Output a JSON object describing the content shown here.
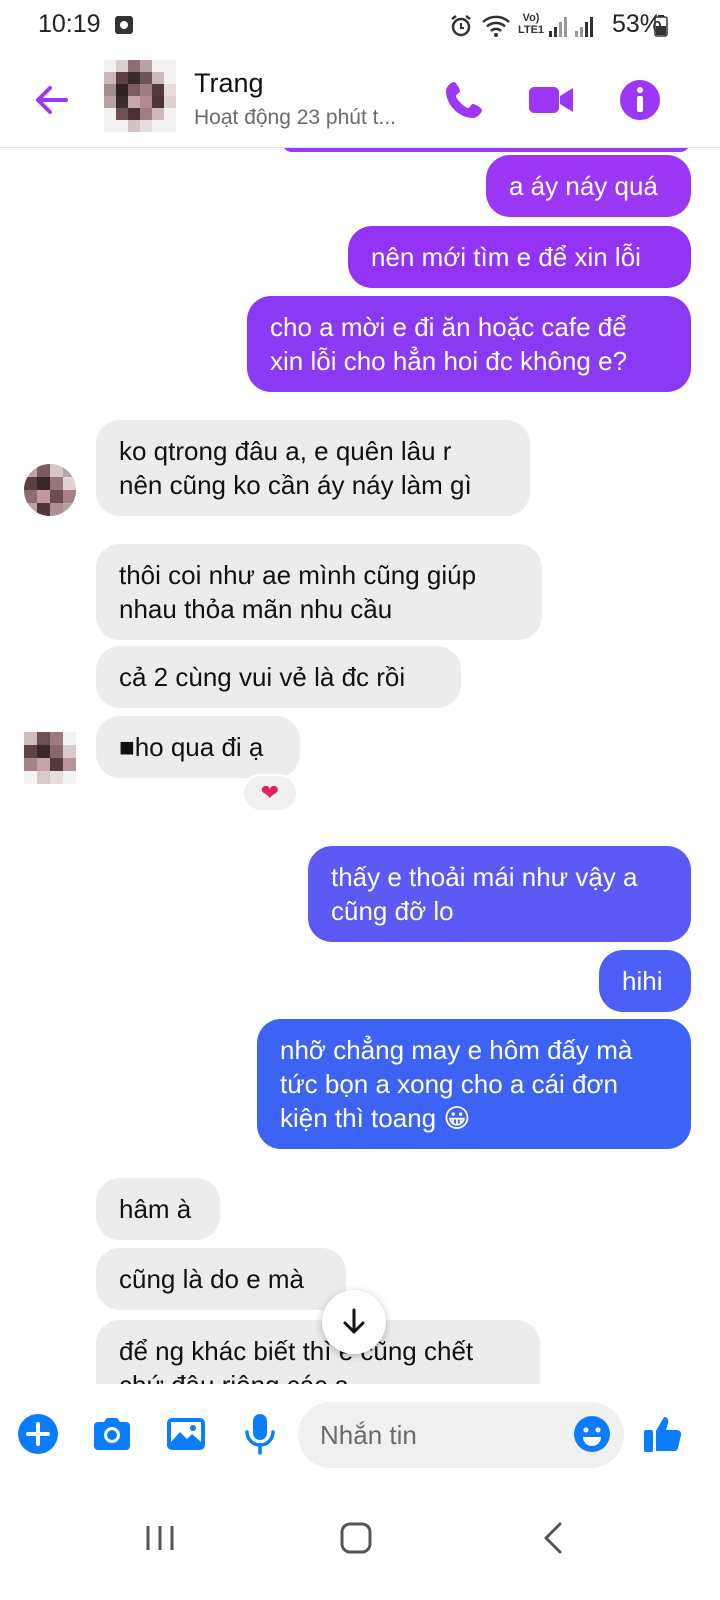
{
  "status_bar": {
    "time": "10:19",
    "network": "Vo) LTE1",
    "battery_text": "53%"
  },
  "header": {
    "contact_name": "Trang",
    "contact_status": "Hoạt động 23 phút t..."
  },
  "colors": {
    "purple": "#9b37f5",
    "violet": "#7a49f5",
    "blue": "#3d63f4",
    "incoming": "#ececec",
    "accent_icon": "#9b37f5",
    "composer_icon": "#0a7cff"
  },
  "messages": [
    {
      "id": "m1",
      "dir": "out",
      "text": "a áy náy quá"
    },
    {
      "id": "m2",
      "dir": "out",
      "text": "nên mới tìm e để xin lỗi"
    },
    {
      "id": "m3",
      "dir": "out",
      "text": "cho a mời e đi ăn hoặc cafe để\nxin lỗi cho hẳn hoi đc không e?"
    },
    {
      "id": "m4",
      "dir": "in",
      "text": "ko qtrong đâu a, e quên lâu r\nnên cũng ko cần áy náy làm gì"
    },
    {
      "id": "m5",
      "dir": "in",
      "text": "thôi coi như ae mình cũng giúp\nnhau thỏa mãn nhu cầu"
    },
    {
      "id": "m6",
      "dir": "in",
      "text": "cả 2 cùng vui vẻ là đc rồi"
    },
    {
      "id": "m7",
      "dir": "in",
      "text": "■ho qua đi ạ",
      "reaction": "❤"
    },
    {
      "id": "m8",
      "dir": "out",
      "text": "thấy e thoải mái như vậy a\ncũng đỡ lo"
    },
    {
      "id": "m9",
      "dir": "out",
      "text": "hihi"
    },
    {
      "id": "m10",
      "dir": "out",
      "text": "nhỡ chẳng may e hôm đấy mà\ntức bọn a xong cho a cái đơn\nkiện thì toang 😀"
    },
    {
      "id": "m11",
      "dir": "in",
      "text": "hâm à"
    },
    {
      "id": "m12",
      "dir": "in",
      "text": "cũng là do e mà"
    },
    {
      "id": "m13",
      "dir": "in",
      "text": "để ng khác biết thì e cũng chết\nchứ đâu riêng các a"
    }
  ],
  "composer": {
    "placeholder": "Nhắn tin"
  },
  "icons": {
    "back": "arrow-left-icon",
    "call": "phone-icon",
    "video": "video-camera-icon",
    "info": "info-icon",
    "plus": "plus-circle-icon",
    "camera": "camera-icon",
    "gallery": "image-icon",
    "mic": "microphone-icon",
    "emoji": "emoji-icon",
    "like": "thumbs-up-icon",
    "scroll_down": "arrow-down-icon"
  }
}
